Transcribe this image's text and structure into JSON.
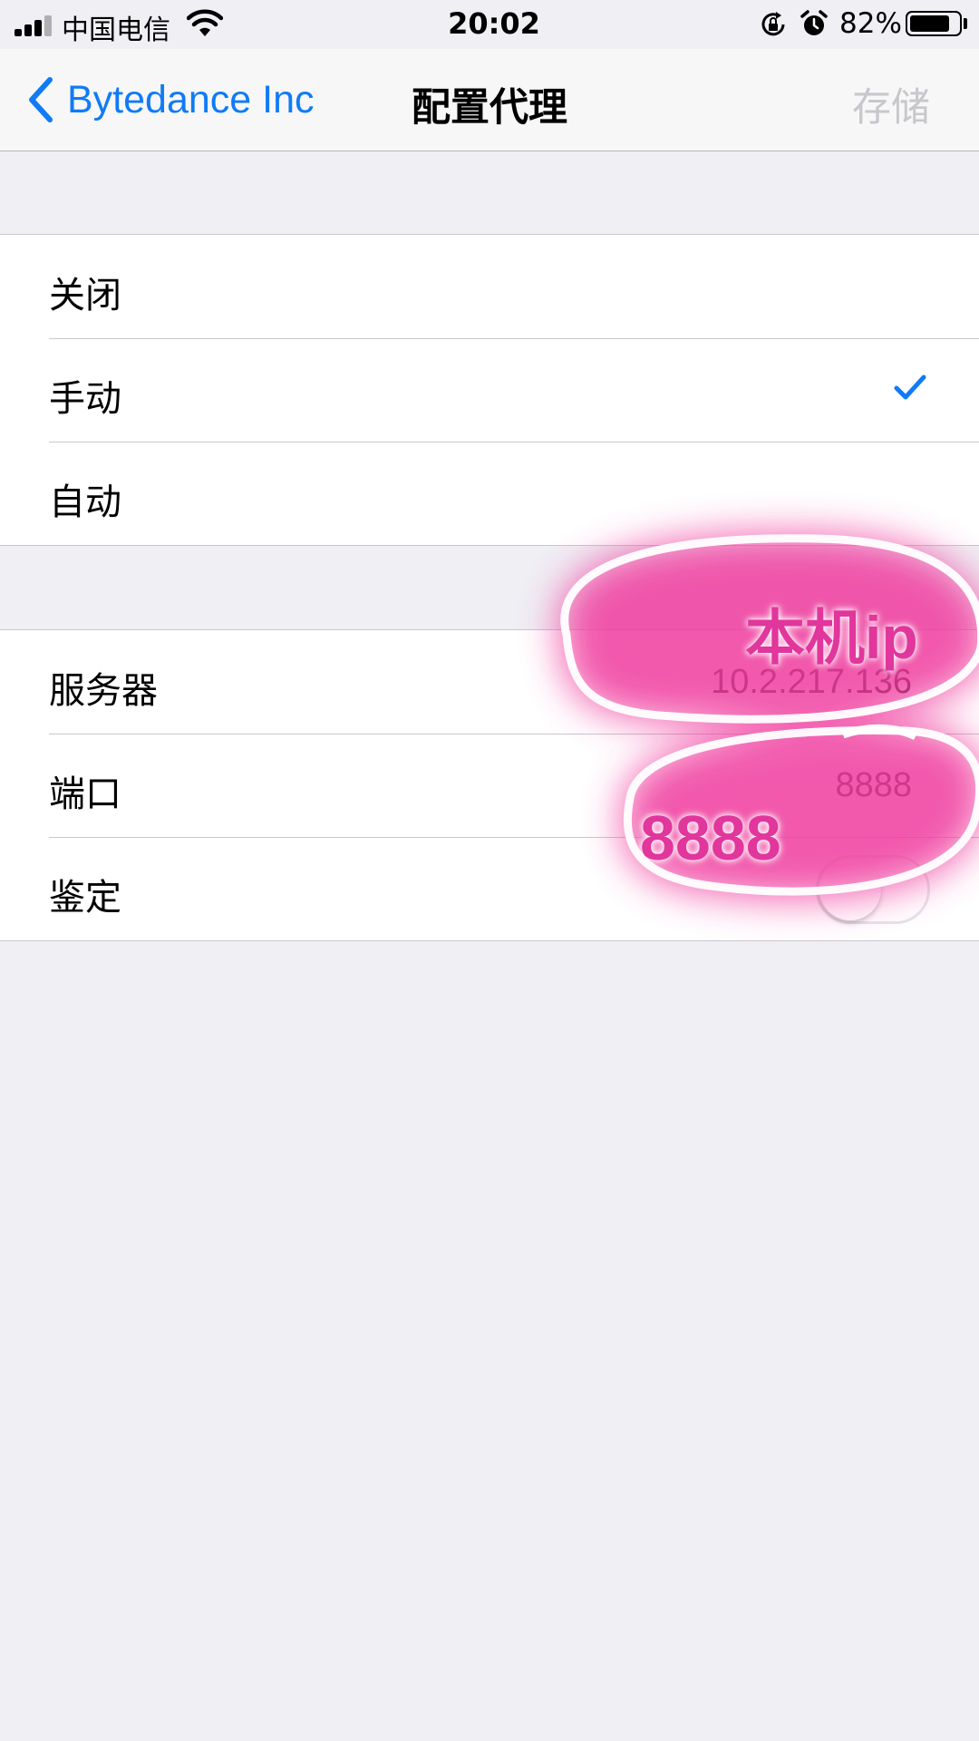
{
  "status_bar": {
    "carrier": "中国电信",
    "time": "20:02",
    "battery_percent": "82%",
    "battery_level": 0.82,
    "icons": [
      "signal-icon",
      "wifi-icon",
      "rotation-lock-icon",
      "alarm-icon",
      "battery-icon"
    ]
  },
  "nav": {
    "back_label": "Bytedance Inc",
    "title": "配置代理",
    "save_label": "存储",
    "accent_color": "#0f7bf6",
    "disabled_color": "#c7c7cc"
  },
  "proxy_modes": {
    "items": [
      {
        "label": "关闭",
        "selected": false
      },
      {
        "label": "手动",
        "selected": true
      },
      {
        "label": "自动",
        "selected": false
      }
    ]
  },
  "manual_settings": {
    "server_label": "服务器",
    "server_value": "10.2.217.136",
    "port_label": "端口",
    "port_value": "8888",
    "auth_label": "鉴定",
    "auth_enabled": false
  },
  "annotations": {
    "ip_note": "本机ip",
    "port_note": "8888",
    "color": "#e1369c"
  }
}
